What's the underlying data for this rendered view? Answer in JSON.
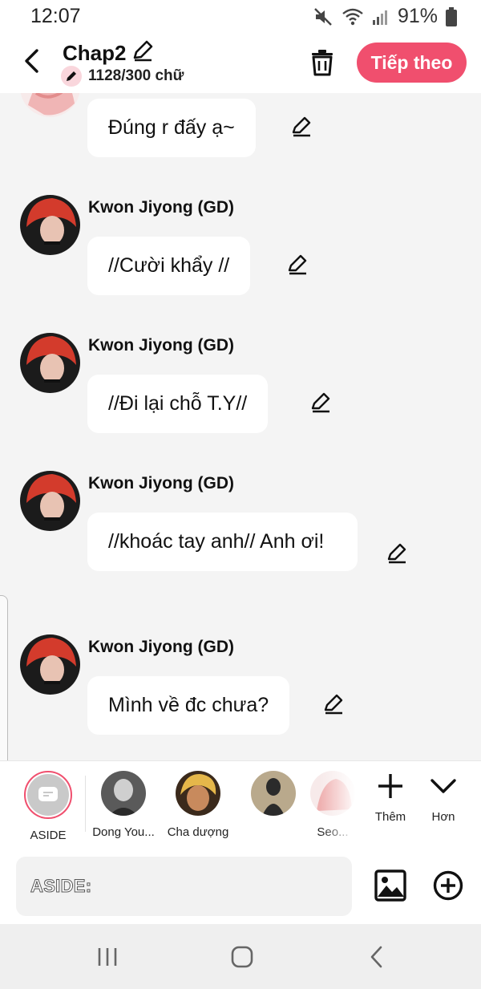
{
  "status_bar": {
    "time": "12:07",
    "battery": "91%"
  },
  "header": {
    "title": "Chap2",
    "char_count": "1128/300 chữ",
    "next_label": "Tiếp theo"
  },
  "messages": [
    {
      "sender": "",
      "text": "Đúng r đấy ạ~"
    },
    {
      "sender": "Kwon Jiyong (GD)",
      "text": "//Cười khẩy //"
    },
    {
      "sender": "Kwon Jiyong (GD)",
      "text": "//Đi lại chỗ T.Y//"
    },
    {
      "sender": "Kwon Jiyong (GD)",
      "text": "//khoác tay anh// Anh ơi!"
    },
    {
      "sender": "Kwon Jiyong (GD)",
      "text": "Mình về đc chưa?"
    }
  ],
  "characters": [
    {
      "label": "ASIDE"
    },
    {
      "label": "Dong You..."
    },
    {
      "label": "Cha dượng"
    },
    {
      "label": ""
    },
    {
      "label": "Seo..."
    }
  ],
  "tools": {
    "more_label": "Thêm",
    "less_label": "Hơn"
  },
  "input": {
    "prefix": "ASIDE:",
    "value": ""
  },
  "colors": {
    "accent": "#f04f6e",
    "background": "#f4f4f4",
    "bubble": "#ffffff"
  }
}
